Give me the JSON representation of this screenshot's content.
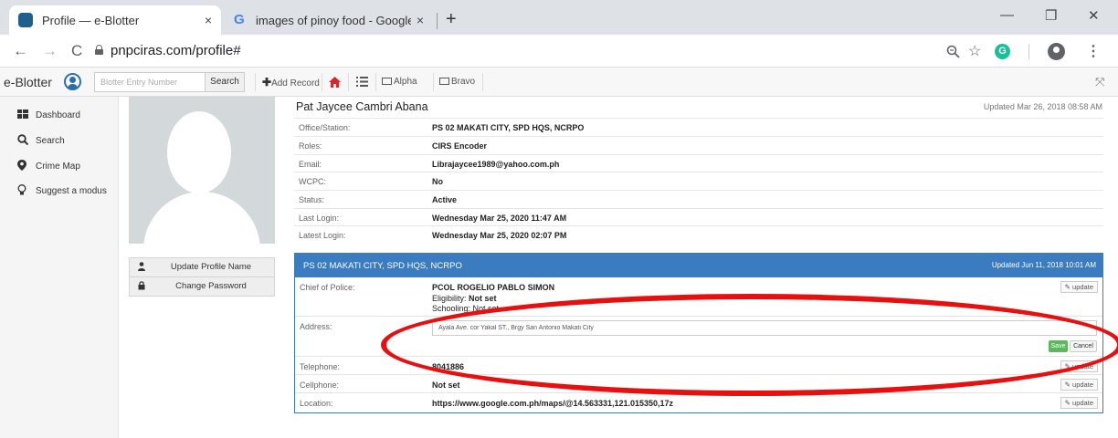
{
  "browser": {
    "tabs": [
      {
        "label": "Profile — e-Blotter",
        "close": "×"
      },
      {
        "label": "images of pinoy food - Google Se",
        "close": "×"
      }
    ],
    "new_tab": "+",
    "window": {
      "minimize": "—",
      "restore": "❐",
      "close": "✕"
    },
    "nav": {
      "back": "←",
      "forward": "→",
      "reload": "C"
    },
    "url": "pnpciras.com/profile#",
    "icons": {
      "zoom": "zoom-icon",
      "star": "star-icon",
      "grammarly": "G",
      "menu": "⋮"
    }
  },
  "app_header": {
    "brand": "e-Blotter",
    "search_placeholder": "Blotter Entry Number",
    "search_button": "Search",
    "add_record": "Add Record",
    "alpha": "Alpha",
    "bravo": "Bravo"
  },
  "sidebar": {
    "items": [
      {
        "label": "Dashboard",
        "icon": "dashboard-icon"
      },
      {
        "label": "Search",
        "icon": "search-icon"
      },
      {
        "label": "Crime Map",
        "icon": "map-marker-icon"
      },
      {
        "label": "Suggest a modus",
        "icon": "lightbulb-icon"
      }
    ]
  },
  "profile_buttons": {
    "update_name": "Update Profile Name",
    "change_password": "Change Password"
  },
  "profile": {
    "name": "Pat Jaycee Cambri Abana",
    "updated": "Updated Mar 26, 2018 08:58 AM",
    "rows": [
      {
        "label": "Office/Station:",
        "value": "PS 02 MAKATI CITY, SPD HQS, NCRPO"
      },
      {
        "label": "Roles:",
        "value": "CIRS Encoder"
      },
      {
        "label": "Email:",
        "value": "Librajaycee1989@yahoo.com.ph"
      },
      {
        "label": "WCPC:",
        "value": "No"
      },
      {
        "label": "Status:",
        "value": "Active"
      },
      {
        "label": "Last Login:",
        "value": "Wednesday Mar 25, 2020 11:47 AM"
      },
      {
        "label": "Latest Login:",
        "value": "Wednesday Mar 25, 2020 02:07 PM"
      }
    ]
  },
  "station": {
    "title": "PS 02 MAKATI CITY, SPD HQS, NCRPO",
    "updated": "Updated Jun 11, 2018 10:01 AM",
    "chief": {
      "label": "Chief of Police:",
      "value": "PCOL ROGELIO PABLO SIMON",
      "eligibility_label": "Eligibility:",
      "eligibility_value": "Not set",
      "schooling": "Schooling: Not set"
    },
    "address": {
      "label": "Address:",
      "value": "Ayala Ave. cor Yakal ST., Brgy San Antonio Makati City",
      "save": "Save",
      "cancel": "Cancel"
    },
    "telephone": {
      "label": "Telephone:",
      "value": "8041886"
    },
    "cellphone": {
      "label": "Cellphone:",
      "value": "Not set"
    },
    "location": {
      "label": "Location:",
      "value": "https://www.google.com.ph/maps/@14.563331,121.015350,17z"
    },
    "update_label": "update"
  },
  "colors": {
    "panel_header": "#3b7bbf",
    "save": "#5cb85c",
    "annotation": "#e80f0f"
  }
}
